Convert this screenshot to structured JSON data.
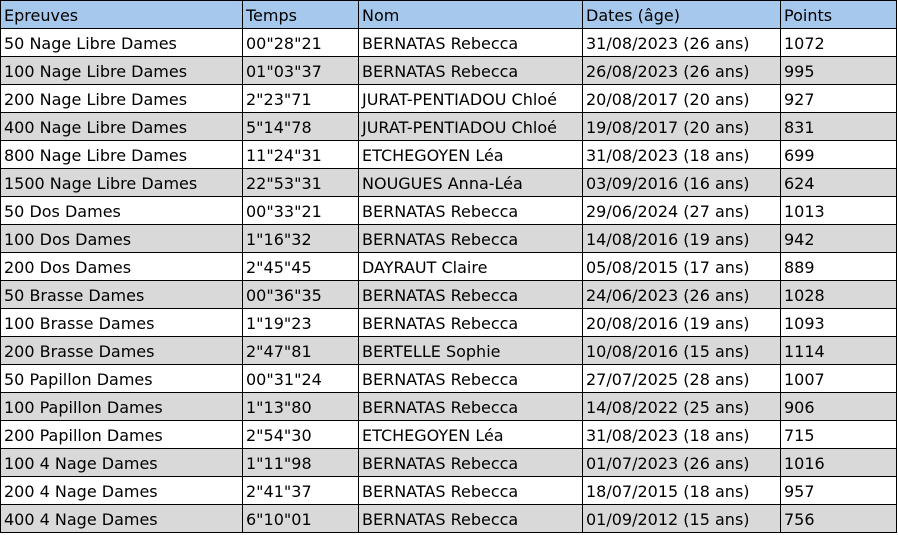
{
  "table": {
    "headers": [
      "Epreuves",
      "Temps",
      "Nom",
      "Dates (âge)",
      "Points"
    ],
    "header_color": "#a6c8ec",
    "stripe_color": "#d9d9d9",
    "rows": [
      [
        "50 Nage Libre Dames",
        "00\"28\"21",
        "BERNATAS Rebecca",
        "31/08/2023 (26 ans)",
        "1072"
      ],
      [
        "100 Nage Libre Dames",
        "01\"03\"37",
        "BERNATAS Rebecca",
        "26/08/2023 (26 ans)",
        "995"
      ],
      [
        "200 Nage Libre Dames",
        "2\"23\"71",
        "JURAT-PENTIADOU Chloé",
        "20/08/2017 (20 ans)",
        "927"
      ],
      [
        "400 Nage Libre Dames",
        "5\"14\"78",
        "JURAT-PENTIADOU Chloé",
        "19/08/2017 (20 ans)",
        "831"
      ],
      [
        "800 Nage Libre Dames",
        "11\"24\"31",
        "ETCHEGOYEN Léa",
        "31/08/2023 (18 ans)",
        "699"
      ],
      [
        "1500 Nage Libre Dames",
        "22\"53\"31",
        "NOUGUES Anna-Léa",
        "03/09/2016 (16 ans)",
        "624"
      ],
      [
        "50 Dos Dames",
        "00\"33\"21",
        "BERNATAS Rebecca",
        "29/06/2024 (27 ans)",
        "1013"
      ],
      [
        "100 Dos Dames",
        "1\"16\"32",
        "BERNATAS Rebecca",
        "14/08/2016 (19 ans)",
        "942"
      ],
      [
        "200 Dos Dames",
        "2\"45\"45",
        "DAYRAUT Claire",
        "05/08/2015 (17 ans)",
        "889"
      ],
      [
        "50 Brasse Dames",
        "00\"36\"35",
        "BERNATAS Rebecca",
        "24/06/2023 (26 ans)",
        "1028"
      ],
      [
        "100 Brasse Dames",
        "1\"19\"23",
        "BERNATAS Rebecca",
        "20/08/2016 (19 ans)",
        "1093"
      ],
      [
        "200 Brasse Dames",
        "2\"47\"81",
        "BERTELLE Sophie",
        "10/08/2016 (15 ans)",
        "1114"
      ],
      [
        "50 Papillon Dames",
        "00\"31\"24",
        "BERNATAS Rebecca",
        "27/07/2025 (28 ans)",
        "1007"
      ],
      [
        "100 Papillon Dames",
        "1\"13\"80",
        "BERNATAS Rebecca",
        "14/08/2022 (25 ans)",
        "906"
      ],
      [
        "200 Papillon Dames",
        "2\"54\"30",
        "ETCHEGOYEN Léa",
        "31/08/2023 (18 ans)",
        "715"
      ],
      [
        "100 4 Nage Dames",
        "1\"11\"98",
        "BERNATAS Rebecca",
        "01/07/2023 (26 ans)",
        "1016"
      ],
      [
        "200 4 Nage Dames",
        "2\"41\"37",
        "BERNATAS Rebecca",
        "18/07/2015 (18 ans)",
        "957"
      ],
      [
        "400 4 Nage Dames",
        "6\"10\"01",
        "BERNATAS Rebecca",
        "01/09/2012 (15 ans)",
        "756"
      ]
    ]
  }
}
